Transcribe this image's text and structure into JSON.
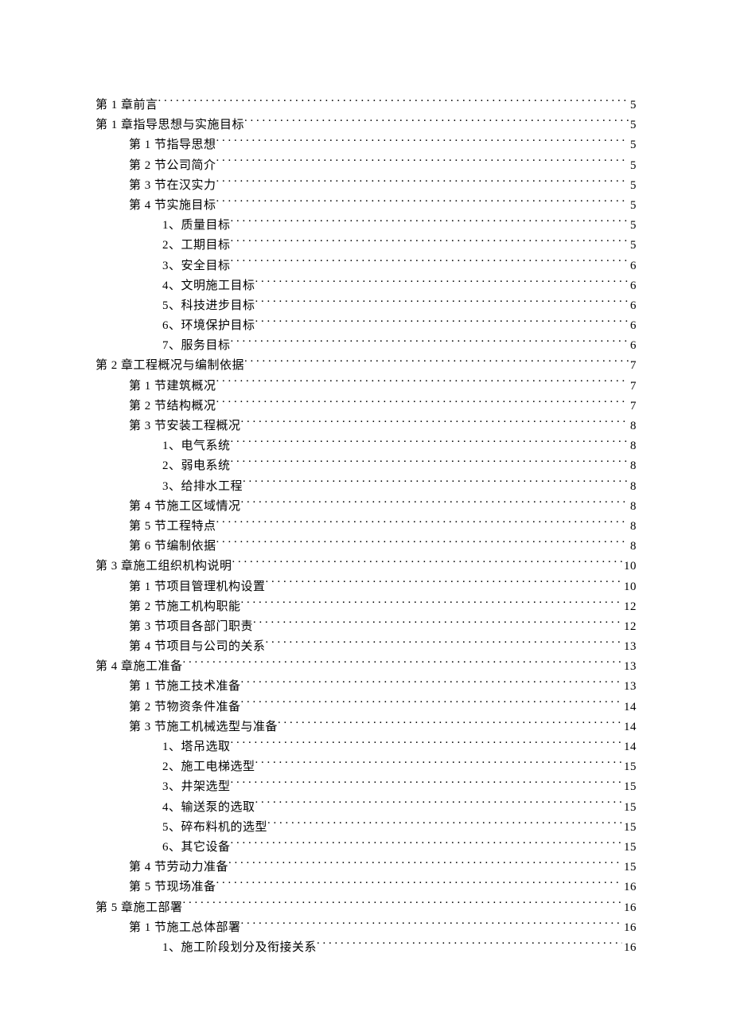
{
  "toc": [
    {
      "level": 0,
      "title": "第 1 章前言",
      "page": "5"
    },
    {
      "level": 0,
      "title": "第 1 章指导思想与实施目标",
      "page": "5"
    },
    {
      "level": 1,
      "title": "第 1 节指导思想",
      "page": "5"
    },
    {
      "level": 1,
      "title": "第 2 节公司简介",
      "page": "5"
    },
    {
      "level": 1,
      "title": "第 3 节在汉实力",
      "page": "5"
    },
    {
      "level": 1,
      "title": "第 4 节实施目标",
      "page": "5"
    },
    {
      "level": 2,
      "title": "1、质量目标",
      "page": "5"
    },
    {
      "level": 2,
      "title": "2、工期目标",
      "page": "5"
    },
    {
      "level": 2,
      "title": "3、安全目标",
      "page": "6"
    },
    {
      "level": 2,
      "title": "4、文明施工目标",
      "page": "6"
    },
    {
      "level": 2,
      "title": "5、科技进步目标",
      "page": "6"
    },
    {
      "level": 2,
      "title": "6、环境保护目标",
      "page": "6"
    },
    {
      "level": 2,
      "title": "7、服务目标",
      "page": "6"
    },
    {
      "level": 0,
      "title": "第 2 章工程概况与编制依据",
      "page": "7"
    },
    {
      "level": 1,
      "title": "第 1 节建筑概况",
      "page": "7"
    },
    {
      "level": 1,
      "title": "第 2 节结构概况",
      "page": "7"
    },
    {
      "level": 1,
      "title": "第 3 节安装工程概况",
      "page": "8"
    },
    {
      "level": 2,
      "title": "1、电气系统",
      "page": "8"
    },
    {
      "level": 2,
      "title": "2、弱电系统",
      "page": "8"
    },
    {
      "level": 2,
      "title": "3、给排水工程",
      "page": "8"
    },
    {
      "level": 1,
      "title": "第 4 节施工区域情况",
      "page": "8"
    },
    {
      "level": 1,
      "title": "第 5 节工程特点",
      "page": "8"
    },
    {
      "level": 1,
      "title": "第 6 节编制依据",
      "page": "8"
    },
    {
      "level": 0,
      "title": "第 3 章施工组织机构说明",
      "page": "10"
    },
    {
      "level": 1,
      "title": "第 1 节项目管理机构设置",
      "page": "10"
    },
    {
      "level": 1,
      "title": "第 2 节施工机构职能",
      "page": "12"
    },
    {
      "level": 1,
      "title": "第 3 节项目各部门职责",
      "page": "12"
    },
    {
      "level": 1,
      "title": "第 4 节项目与公司的关系",
      "page": "13"
    },
    {
      "level": 0,
      "title": "第 4 章施工准备",
      "page": "13"
    },
    {
      "level": 1,
      "title": "第 1 节施工技术准备",
      "page": "13"
    },
    {
      "level": 1,
      "title": "第 2 节物资条件准备",
      "page": "14"
    },
    {
      "level": 1,
      "title": "第 3 节施工机械选型与准备",
      "page": "14"
    },
    {
      "level": 2,
      "title": "1、塔吊选取",
      "page": "14"
    },
    {
      "level": 2,
      "title": "2、施工电梯选型",
      "page": "15"
    },
    {
      "level": 2,
      "title": "3、井架选型",
      "page": "15"
    },
    {
      "level": 2,
      "title": "4、输送泵的选取",
      "page": "15"
    },
    {
      "level": 2,
      "title": "5、碎布料机的选型",
      "page": "15"
    },
    {
      "level": 2,
      "title": "6、其它设备",
      "page": "15"
    },
    {
      "level": 1,
      "title": "第 4 节劳动力准备",
      "page": "15"
    },
    {
      "level": 1,
      "title": "第 5 节现场准备",
      "page": "16"
    },
    {
      "level": 0,
      "title": "第 5 章施工部署",
      "page": "16"
    },
    {
      "level": 1,
      "title": "第 1 节施工总体部署",
      "page": "16"
    },
    {
      "level": 2,
      "title": "1、施工阶段划分及衔接关系",
      "page": "16"
    }
  ]
}
